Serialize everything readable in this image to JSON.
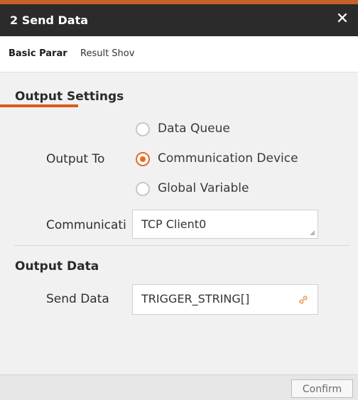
{
  "dialog": {
    "title": "2 Send Data",
    "close_icon": "close-icon"
  },
  "tabs": [
    {
      "label": "Basic Parar",
      "active": true
    },
    {
      "label": "Result Shov",
      "active": false
    }
  ],
  "output_settings": {
    "heading": "Output Settings",
    "output_to_label": "Output To",
    "options": [
      {
        "label": "Data Queue",
        "selected": false
      },
      {
        "label": "Communication Device",
        "selected": true
      },
      {
        "label": "Global Variable",
        "selected": false
      }
    ],
    "communication_label": "Communicati",
    "communication_value": "TCP Client0"
  },
  "output_data": {
    "heading": "Output Data",
    "send_data_label": "Send Data",
    "send_data_value": "TRIGGER_STRING[]",
    "link_icon": "link-icon"
  },
  "footer": {
    "confirm_label": "Confirm"
  },
  "colors": {
    "accent": "#e56a26",
    "titlebar": "#2b2b2b"
  }
}
